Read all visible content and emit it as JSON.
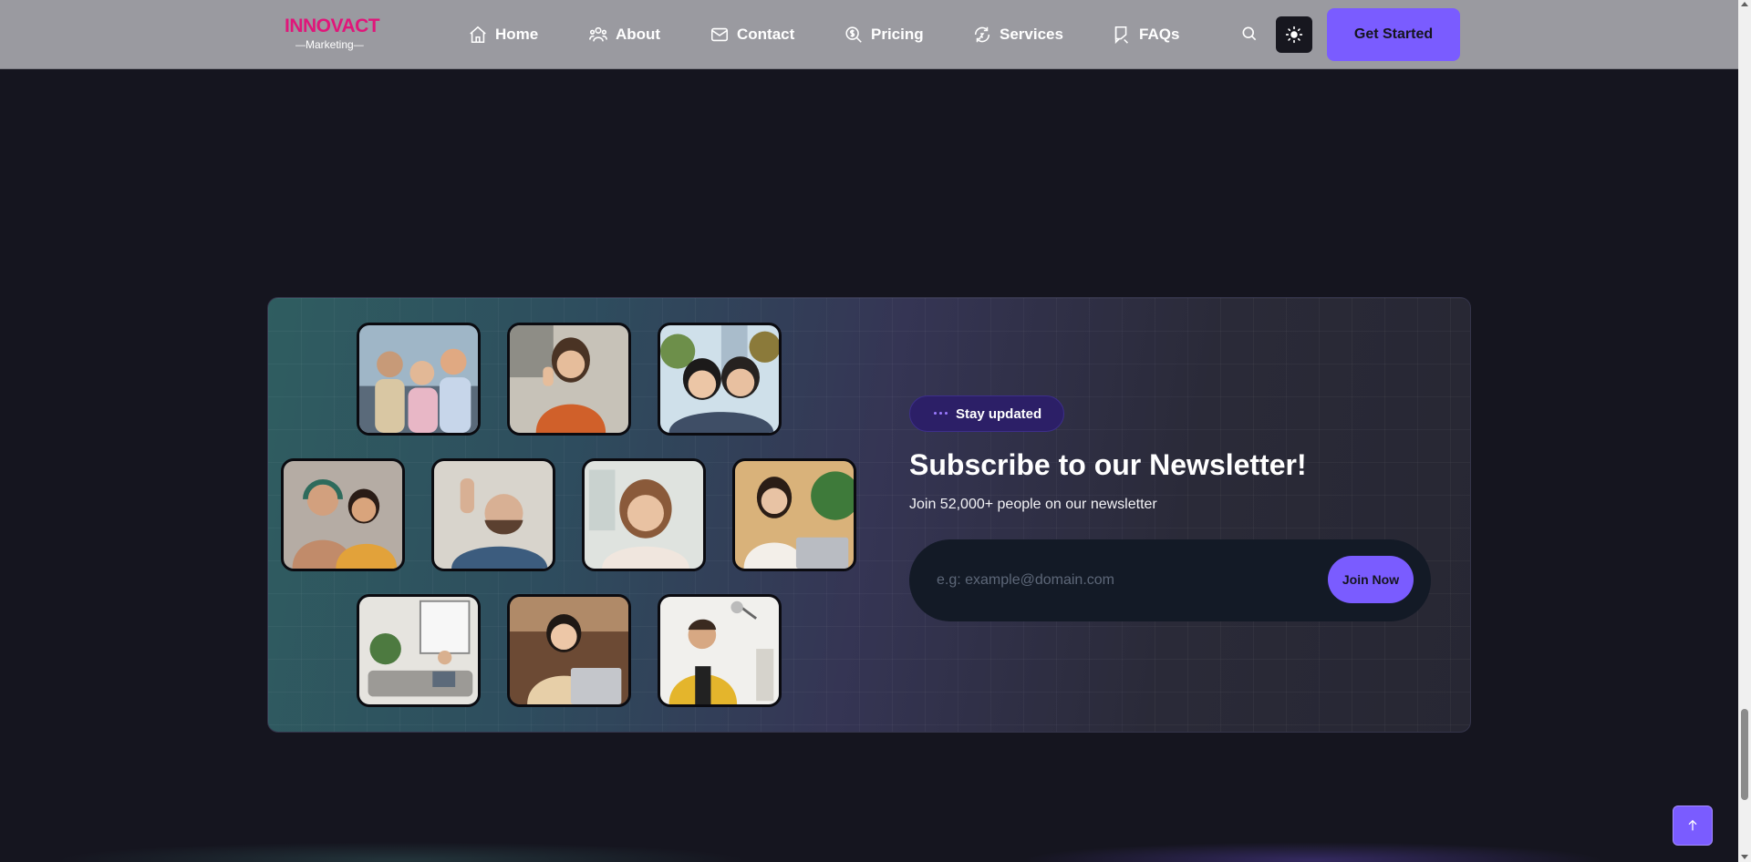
{
  "header": {
    "logo_main": "INNOVACT",
    "logo_sub": "Marketing",
    "nav": [
      {
        "label": "Home",
        "icon": "home-icon"
      },
      {
        "label": "About",
        "icon": "users-icon"
      },
      {
        "label": "Contact",
        "icon": "mail-icon"
      },
      {
        "label": "Pricing",
        "icon": "pricing-icon"
      },
      {
        "label": "Services",
        "icon": "services-icon"
      },
      {
        "label": "FAQs",
        "icon": "faq-icon"
      }
    ],
    "search_icon": "search-icon",
    "theme_icon": "sun-icon",
    "cta_label": "Get Started"
  },
  "newsletter": {
    "badge": "Stay updated",
    "title": "Subscribe to our Newsletter!",
    "subtitle": "Join 52,000+ people on our newsletter",
    "email_placeholder": "e.g: example@domain.com",
    "button_label": "Join Now",
    "photos": [
      "group-selfie-photo",
      "woman-waving-photo",
      "friends-selfie-photo",
      "couple-headphones-photo",
      "man-waving-photo",
      "woman-smiling-photo",
      "woman-cafe-photo",
      "woman-living-room-photo",
      "woman-laptop-photo",
      "man-yellow-jacket-photo"
    ]
  },
  "footer": {
    "back_to_top_icon": "arrow-up-icon"
  },
  "colors": {
    "accent": "#7a5cff",
    "brand": "#e0167a",
    "background": "#15151f",
    "header": "#9a9aa0"
  }
}
